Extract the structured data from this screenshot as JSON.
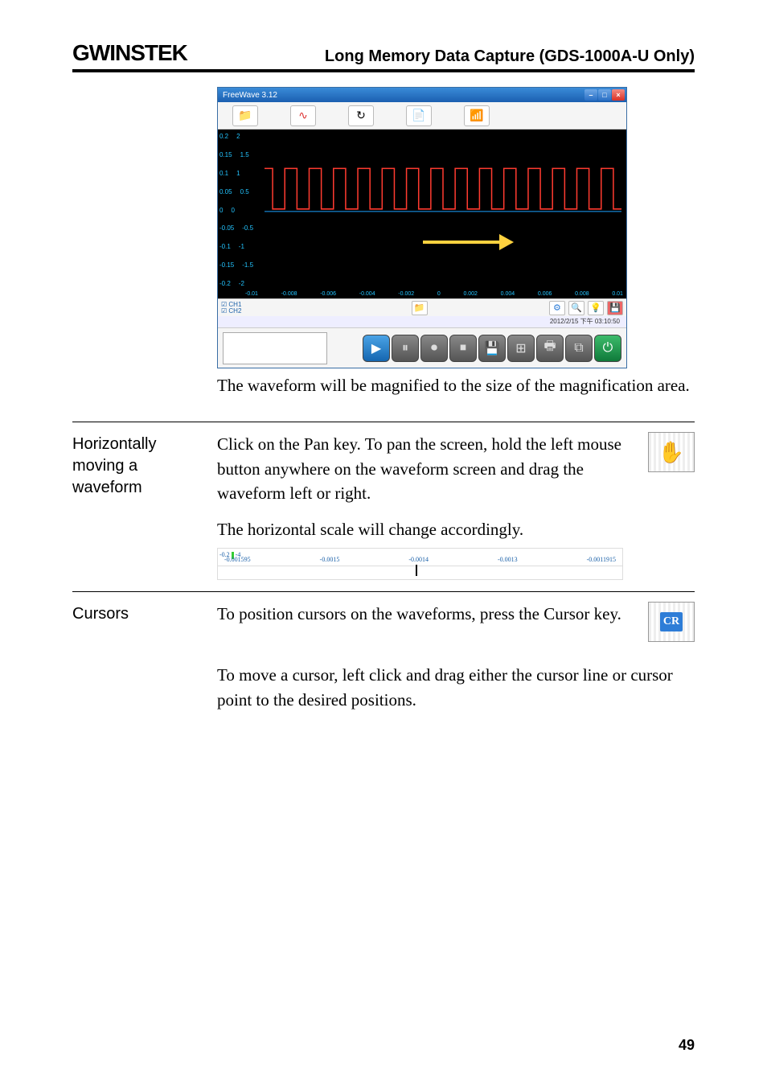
{
  "header": {
    "logo_text": "GWINSTEK",
    "title": "Long Memory Data Capture (GDS-1000A-U Only)"
  },
  "screenshot": {
    "window_title": "FreeWave 3.12",
    "y_axis_left": [
      "0.2",
      "0.15",
      "0.1",
      "0.05",
      "0",
      "-0.05",
      "-0.1",
      "-0.15",
      "-0.2"
    ],
    "y_axis_right": [
      "2",
      "1.5",
      "1",
      "0.5",
      "0",
      "-0.5",
      "-1",
      "-1.5",
      "-2"
    ],
    "x_axis": [
      "-0.01",
      "-0.008",
      "-0.006",
      "-0.004",
      "-0.002",
      "0",
      "0.002",
      "0.004",
      "0.006",
      "0.008",
      "0.01"
    ],
    "ch1_label": "CH1",
    "ch2_label": "CH2",
    "timestamp": "2012/2/15 下午 03:10:50"
  },
  "caption1": "The waveform will be magnified to the size of the magnification area.",
  "section_pan": {
    "label": "Horizontally moving a waveform",
    "p1": "Click on the Pan key.  To pan the screen, hold the left mouse button anywhere on the waveform screen and drag the waveform left or right.",
    "p2": "The horizontal scale will change accordingly."
  },
  "hscale": {
    "yl": "-0.2",
    "yl2": "-4",
    "ticks": [
      "-0.001595",
      "-0.0015",
      "-0.0014",
      "-0.0013",
      "-0.0011915"
    ]
  },
  "section_cursor": {
    "label": "Cursors",
    "p1": "To position cursors on the waveforms, press the Cursor key.",
    "p2": "To move a cursor, left click and drag either the cursor line or cursor point to the desired positions.",
    "cr": "CR"
  },
  "icons": {
    "pan": "✋",
    "folder": "📁",
    "wave": "∿",
    "reload": "↻",
    "doc": "📄",
    "sig": "📶",
    "play": "▶",
    "pause": "⏸",
    "rec": "⏺",
    "stop": "⏹",
    "save": "💾",
    "grid": "⊞",
    "print": "🖶",
    "crop": "⧉",
    "power": "⏻",
    "gear": "⚙",
    "zoom": "🔍",
    "bulb": "💡",
    "disk": "💾",
    "min": "–",
    "max": "□",
    "close": "×"
  },
  "page_number": "49"
}
